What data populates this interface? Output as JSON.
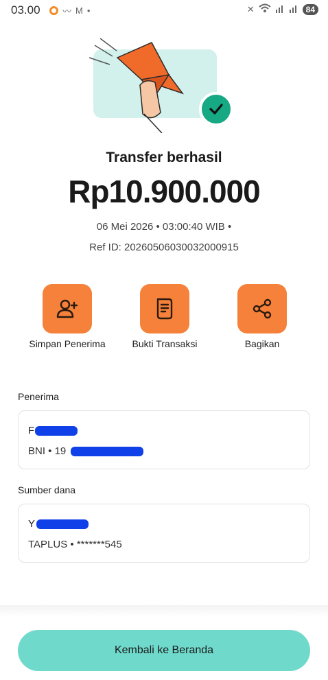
{
  "status_bar": {
    "time": "03.00",
    "battery": "84"
  },
  "receipt": {
    "title": "Transfer berhasil",
    "amount": "Rp10.900.000",
    "datetime": "06 Mei 2026 • 03:00:40 WIB •",
    "ref_id": "Ref ID: 20260506030032000915"
  },
  "actions": [
    {
      "label": "Simpan Penerima",
      "icon": "add-user-icon"
    },
    {
      "label": "Bukti Transaksi",
      "icon": "receipt-icon"
    },
    {
      "label": "Bagikan",
      "icon": "share-icon"
    }
  ],
  "recipient": {
    "section_label": "Penerima",
    "name": "F",
    "account": "BNI • 19"
  },
  "source": {
    "section_label": "Sumber dana",
    "name": "Y",
    "account": "TAPLUS • *******545"
  },
  "footer": {
    "home_button": "Kembali ke Beranda"
  },
  "colors": {
    "accent_orange": "#f5813a",
    "success_green": "#17a884",
    "button_teal": "#6fd9cb",
    "redaction_blue": "#1040e8"
  }
}
